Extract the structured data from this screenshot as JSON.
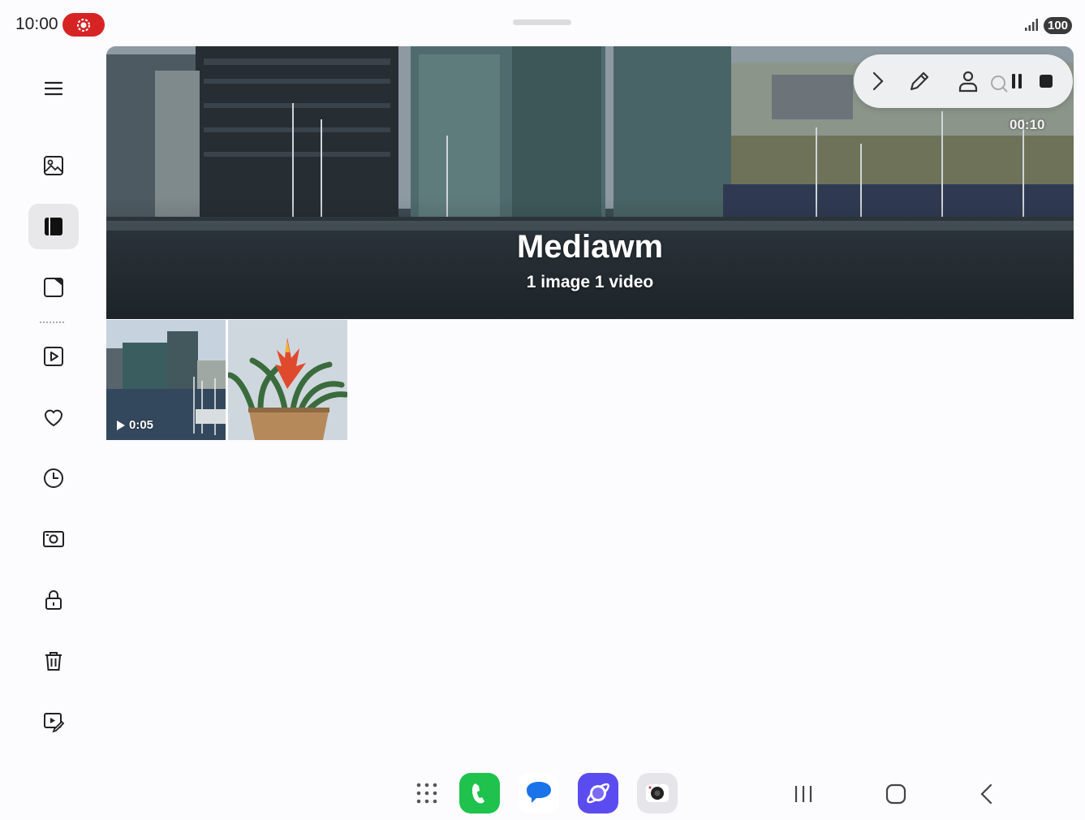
{
  "status_bar": {
    "time": "10:00",
    "battery": "100"
  },
  "sidebar": {
    "items": [
      {
        "name": "menu-icon"
      },
      {
        "name": "pictures-icon"
      },
      {
        "name": "albums-icon",
        "active": true
      },
      {
        "name": "stories-icon"
      },
      {
        "name": "videos-icon"
      },
      {
        "name": "favourites-icon"
      },
      {
        "name": "recent-icon"
      },
      {
        "name": "screenshots-icon"
      },
      {
        "name": "secure-folder-icon"
      },
      {
        "name": "recycle-bin-icon"
      },
      {
        "name": "video-editor-icon"
      }
    ]
  },
  "album": {
    "title": "Mediawm",
    "subtitle": "1 image 1 video"
  },
  "recorder": {
    "timer": "00:10",
    "buttons": [
      "expand",
      "draw",
      "selfie",
      "pause",
      "stop"
    ]
  },
  "thumbnails": [
    {
      "type": "video",
      "duration": "0:05",
      "subject": "harbor buildings"
    },
    {
      "type": "image",
      "subject": "potted bromeliad"
    }
  ],
  "taskbar": {
    "apps": [
      "apps-grid",
      "phone",
      "messages",
      "internet",
      "camera"
    ],
    "nav": [
      "recents",
      "home",
      "back"
    ]
  },
  "colors": {
    "record": "#d62424",
    "phone": "#1ec24d",
    "messages": "#1a73e8",
    "internet": "#5b4cf0"
  }
}
